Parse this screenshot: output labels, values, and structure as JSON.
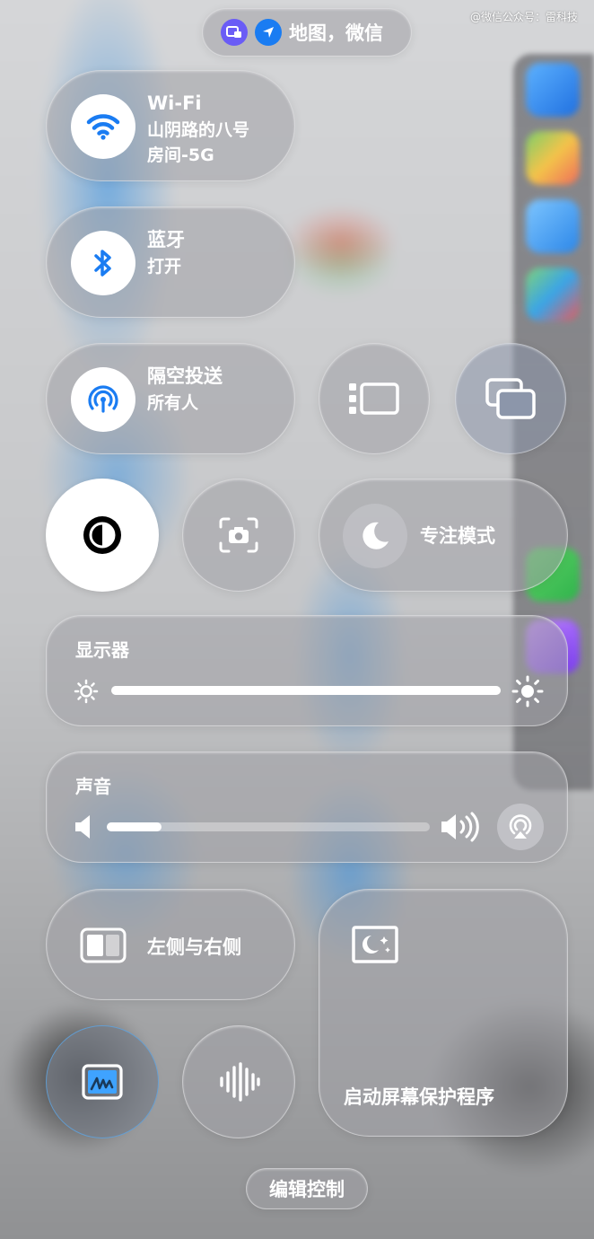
{
  "watermark": "@微信公众号：雷科技",
  "status_pill": {
    "apps_label": "地图，微信"
  },
  "wifi": {
    "title": "Wi-Fi",
    "network_line1": "山阴路的八号",
    "network_line2": "房间-5G"
  },
  "bluetooth": {
    "title": "蓝牙",
    "status": "打开"
  },
  "airdrop": {
    "title": "隔空投送",
    "status": "所有人"
  },
  "focus": {
    "label": "专注模式"
  },
  "display": {
    "label": "显示器",
    "brightness_percent": 100
  },
  "sound": {
    "label": "声音",
    "volume_percent": 17
  },
  "layout": {
    "label": "左侧与右侧"
  },
  "screensaver": {
    "label": "启动屏幕保护程序"
  },
  "edit": {
    "label": "编辑控制"
  },
  "colors": {
    "accent": "#1a7cf2",
    "active": "#1a7cf2",
    "glass": "#a0a0a5"
  },
  "icons": [
    "location-arrow-icon",
    "stage-manager-badge-icon",
    "wifi-icon",
    "bluetooth-icon",
    "airdrop-icon",
    "stage-manager-icon",
    "screen-mirroring-icon",
    "dark-mode-icon",
    "screenshot-icon",
    "moon-icon",
    "sun-icon",
    "speaker-icon",
    "airplay-icon",
    "split-view-icon",
    "screensaver-icon",
    "quick-note-icon",
    "sound-recognition-icon"
  ]
}
